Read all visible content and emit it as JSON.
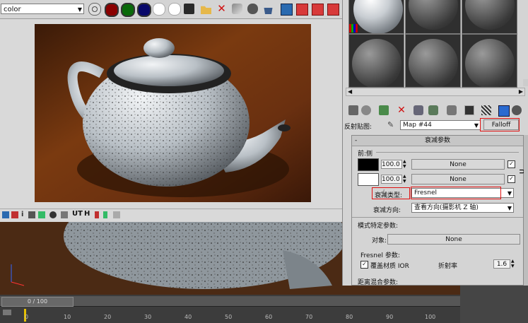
{
  "render_window": {
    "channel_select": "color"
  },
  "material_editor": {
    "map_label": "反射贴图:",
    "map_name": "Map #44",
    "map_type": "Falloff",
    "panel_title": "衰减参数",
    "front_side_label": "前:侧",
    "front_amount": "100.0",
    "front_map": "None",
    "side_amount": "100.0",
    "side_map": "None",
    "falloff_type_label": "衰减类型:",
    "falloff_type": "Fresnel",
    "falloff_dir_label": "衰减方向:",
    "falloff_dir": "查看方向(摄影机 Z 轴)",
    "mode_params_label": "模式特定参数:",
    "object_label": "对象:",
    "object_value": "None",
    "fresnel_params_label": "Fresnel 参数:",
    "override_ior_label": "覆盖材质 IOR",
    "ior_label": "折射率",
    "ior_value": "1.6",
    "distance_blend_label": "距离混合参数:",
    "collapse_mark": "-"
  },
  "timeline": {
    "frame_counter": "0 / 100",
    "ticks": [
      "0",
      "10",
      "20",
      "30",
      "40",
      "50",
      "60",
      "70",
      "80",
      "90",
      "100"
    ]
  },
  "colors": {
    "wood": "#5a2a0c",
    "highlight_red": "#e01010",
    "panel_gray": "#d4d4d4"
  }
}
